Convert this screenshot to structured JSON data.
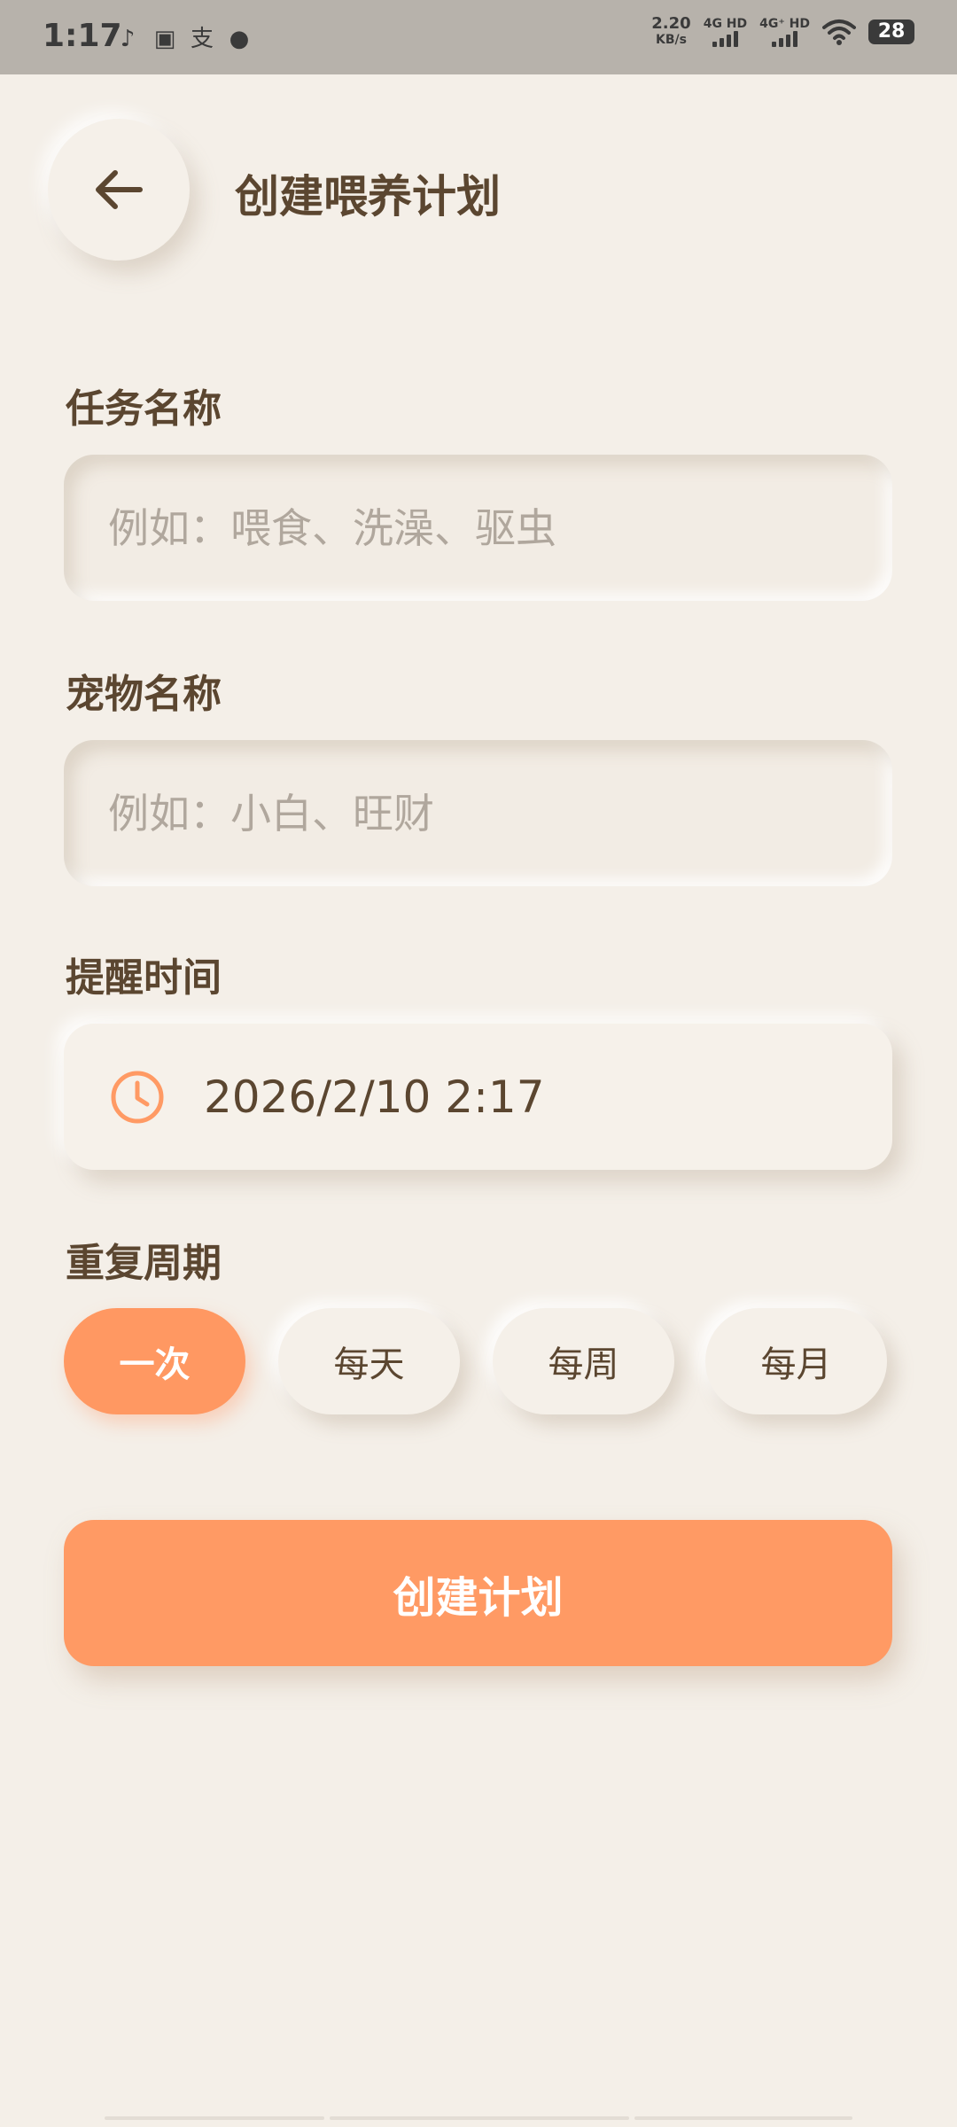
{
  "status_bar": {
    "time": "1:17",
    "speed_value": "2.20",
    "speed_unit": "KB/s",
    "sim1_label": "4G HD",
    "sim2_label": "4G⁺ HD",
    "battery": "28"
  },
  "header": {
    "title": "创建喂养计划"
  },
  "form": {
    "task_name": {
      "label": "任务名称",
      "placeholder": "例如：喂食、洗澡、驱虫",
      "value": ""
    },
    "pet_name": {
      "label": "宠物名称",
      "placeholder": "例如：小白、旺财",
      "value": ""
    },
    "remind_time": {
      "label": "提醒时间",
      "value": "2026/2/10 2:17"
    },
    "repeat": {
      "label": "重复周期",
      "options": [
        "一次",
        "每天",
        "每周",
        "每月"
      ],
      "selected": "一次"
    }
  },
  "actions": {
    "create_label": "创建计划"
  },
  "colors": {
    "accent": "#ff9a64",
    "background": "#f4efe8",
    "text": "#5b4630"
  }
}
